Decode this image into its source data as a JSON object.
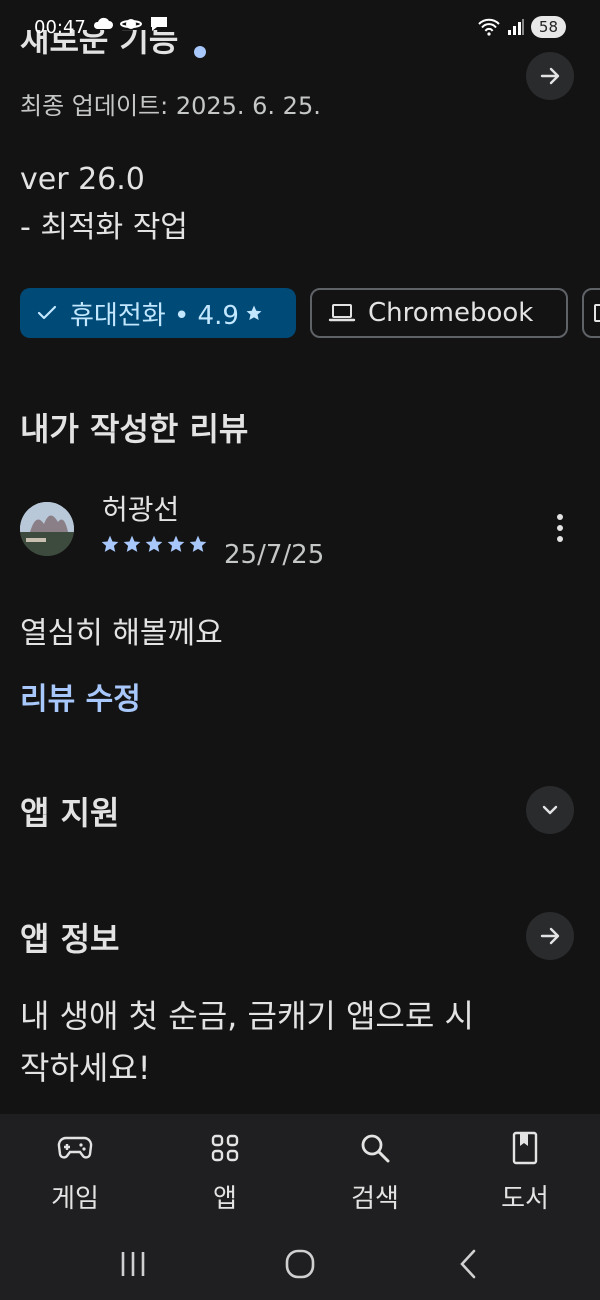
{
  "status": {
    "time": "00:47",
    "battery": "58",
    "notification_icons": [
      "cloud-icon",
      "planet-icon",
      "chat-icon"
    ]
  },
  "whats_new": {
    "title": "새로운 기능",
    "updated": "최종 업데이트: 2025. 6. 25.",
    "version": "ver 26.0",
    "note": "- 최적화 작업"
  },
  "device_chips": [
    {
      "label": "휴대전화 • 4.9",
      "selected": true
    },
    {
      "label": "Chromebook",
      "selected": false
    }
  ],
  "my_review": {
    "heading": "내가 작성한 리뷰",
    "reviewer": "허광선",
    "rating": 5,
    "date": "25/7/25",
    "text": "열심히 해볼께요",
    "edit_label": "리뷰 수정"
  },
  "app_support": {
    "heading": "앱 지원"
  },
  "about": {
    "heading": "앱 정보",
    "description": "내 생애 첫 순금, 금캐기 앱으로 시작하세요!"
  },
  "bottom_nav": [
    {
      "label": "게임",
      "icon": "gamepad-icon"
    },
    {
      "label": "앱",
      "icon": "apps-grid-icon"
    },
    {
      "label": "검색",
      "icon": "search-icon"
    },
    {
      "label": "도서",
      "icon": "book-icon"
    }
  ],
  "colors": {
    "background": "#131313",
    "accent": "#a8c7fa",
    "chip_selected_bg": "#004a77",
    "chip_selected_text": "#c2e7ff"
  }
}
